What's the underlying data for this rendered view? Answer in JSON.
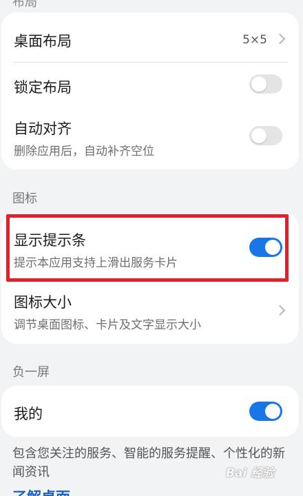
{
  "top_section_label": "布局",
  "layout_card": {
    "desktop_layout": {
      "title": "桌面布局",
      "value": "5×5"
    },
    "lock_layout": {
      "title": "锁定布局",
      "toggle": "off"
    },
    "auto_align": {
      "title": "自动对齐",
      "subtitle": "删除应用后，自动补齐空位",
      "toggle": "off"
    }
  },
  "icon_section_label": "图标",
  "icon_card": {
    "show_hint_bar": {
      "title": "显示提示条",
      "subtitle": "提示本应用支持上滑出服务卡片",
      "toggle": "on"
    },
    "icon_size": {
      "title": "图标大小",
      "subtitle": "调节桌面图标、卡片及文字显示大小"
    }
  },
  "minus_one_section_label": "负一屏",
  "minus_one_card": {
    "mine": {
      "title": "我的",
      "toggle": "on"
    }
  },
  "footnote": "包含您关注的服务、智能的服务提醒、个性化的新闻资讯",
  "bottom_partial": "了解桌面",
  "watermark": "Bai 经验",
  "colors": {
    "accent": "#1877e6",
    "highlight_box": "#e41e2b",
    "background": "#f1f3f5"
  }
}
